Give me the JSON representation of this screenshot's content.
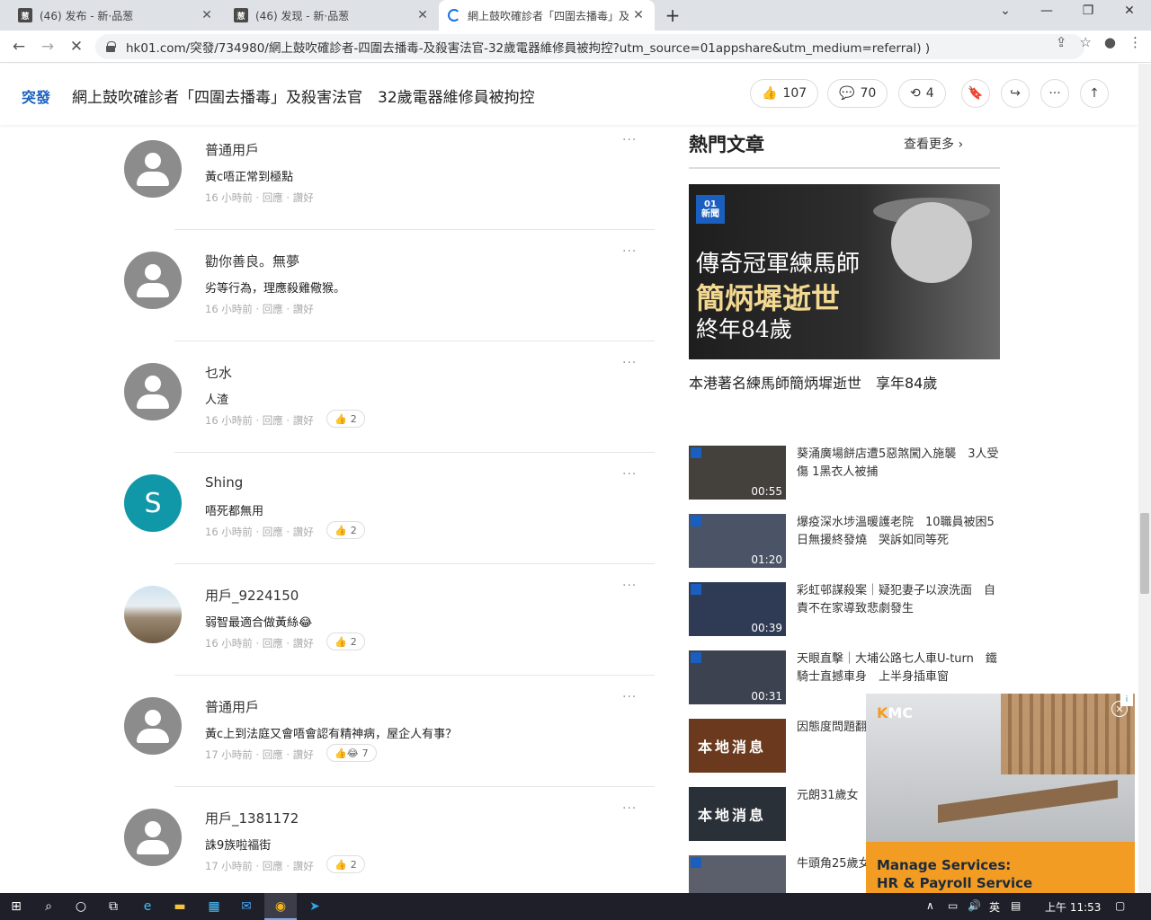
{
  "browser": {
    "tabs": [
      {
        "title": "(46) 发布 - 新·品葱",
        "favicon": "葱"
      },
      {
        "title": "(46) 发现 - 新·品葱",
        "favicon": "葱"
      },
      {
        "title": "網上鼓吹確診者「四圍去播毒」及",
        "favicon": ""
      }
    ],
    "url": "hk01.com/突發/734980/網上鼓吹確診者-四圍去播毒-及殺害法官-32歲電器維修員被拘控?utm_source=01appshare&utm_medium=referral) )"
  },
  "header": {
    "category": "突發",
    "headline": "網上鼓吹確診者「四圍去播毒」及殺害法官　32歲電器維修員被拘控",
    "like_count": "107",
    "comment_count": "70",
    "share_count": "4"
  },
  "comments": [
    {
      "name": "普通用戶",
      "text": "黃c唔正常到極點",
      "meta": "16 小時前 · 回應 · 讚好",
      "likes": ""
    },
    {
      "name": "勸你善良。無夢",
      "text": "劣等行為，理應殺雞儆猴。",
      "meta": "16 小時前 · 回應 · 讚好",
      "likes": ""
    },
    {
      "name": "乜水",
      "text": "人渣",
      "meta": "16 小時前 · 回應 · 讚好",
      "likes": "2"
    },
    {
      "name": "Shing",
      "text": "唔死都無用",
      "meta": "16 小時前 · 回應 · 讚好",
      "likes": "2",
      "avatar_letter": "S"
    },
    {
      "name": "用戶_9224150",
      "text": "弱智最適合做黃絲😂",
      "meta": "16 小時前 · 回應 · 讚好",
      "likes": "2"
    },
    {
      "name": "普通用戶",
      "text": "黃c上到法庭又會唔會認有精神病，屋企人有事？",
      "meta": "17 小時前 · 回應 · 讚好",
      "likes": "7"
    },
    {
      "name": "用戶_1381172",
      "text": "誅9族啦福街",
      "meta": "17 小時前 · 回應 · 讚好",
      "likes": "2"
    }
  ],
  "sidebar": {
    "title": "熱門文章",
    "see_more": "查看更多",
    "feature": {
      "logo_top": "01",
      "logo_bottom": "新聞",
      "line1": "傳奇冠軍練馬師",
      "line2": "簡炳墀逝世",
      "line3": "終年84歲",
      "caption": "本港著名練馬師簡炳墀逝世　享年84歲"
    },
    "news": [
      {
        "title": "葵涌廣場餅店遭5惡煞闖入施襲　3人受傷 1黑衣人被捕",
        "duration": "00:55"
      },
      {
        "title": "爆疫深水埗溫暖護老院　10職員被困5日無援終發燒　哭訴如同等死",
        "duration": "01:20"
      },
      {
        "title": "彩虹邨謀殺案｜疑犯妻子以淚洗面　自責不在家導致悲劇發生",
        "duration": "00:39"
      },
      {
        "title": "天眼直擊｜大埔公路七人車U-turn　鐵騎士直撼車身　上半身插車窗",
        "duration": "00:31"
      },
      {
        "title": "因態度問題翻　新傷腳　警拘",
        "duration": "",
        "thumb_text": "本地消息"
      },
      {
        "title": "元朗31歲女　治",
        "duration": "",
        "thumb_text": "本地消息"
      },
      {
        "title": "牛頭角25歲女　嬰　自行求醫",
        "duration": ""
      }
    ]
  },
  "ad": {
    "brand": "KMC",
    "line1": "Manage Services:",
    "line2": "HR & Payroll Service"
  },
  "taskbar": {
    "ime": "英",
    "time": "上午 11:53"
  }
}
